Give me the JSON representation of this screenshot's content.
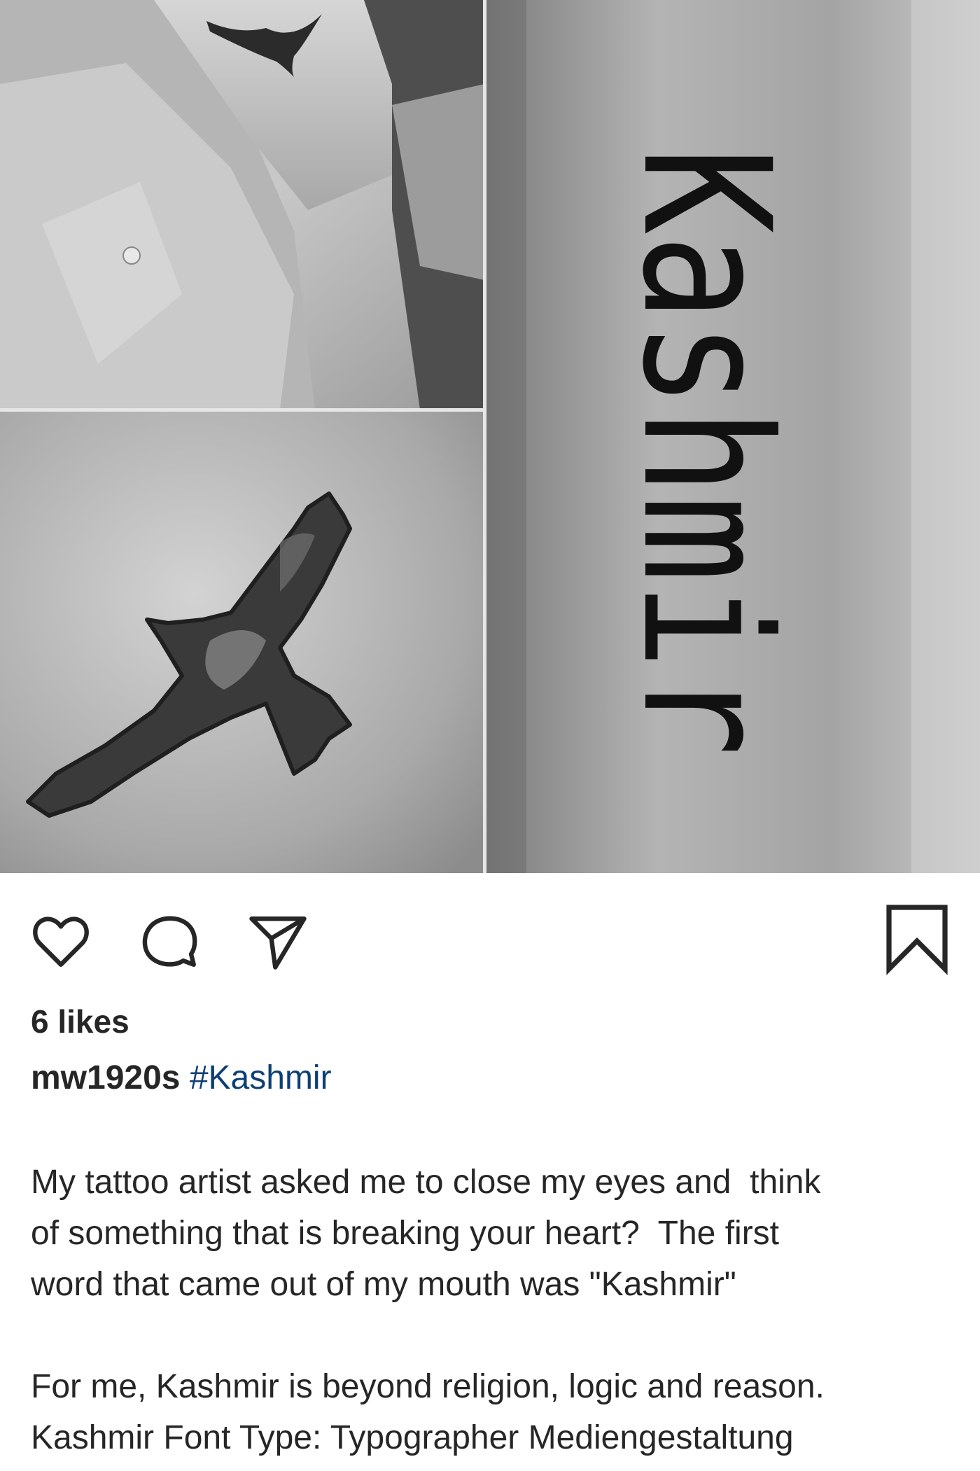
{
  "post": {
    "likes": "6 likes",
    "username": "mw1920s",
    "hashtag": "#Kashmir",
    "caption_lines": [
      "My tattoo artist asked me to close my eyes and  think",
      "of something that is breaking your heart?  The first",
      "word that came out of my mouth was \"Kashmir\""
    ],
    "caption_lines_2": [
      "For me, Kashmir is beyond religion, logic and reason.",
      "Kashmir Font Type: Typographer Mediengestaltung"
    ]
  },
  "photos": {
    "tattoo_text": "Kashmir"
  },
  "actions": {
    "like_icon": "heart-icon",
    "comment_icon": "comment-icon",
    "share_icon": "paper-plane-icon",
    "save_icon": "bookmark-icon"
  },
  "colors": {
    "hashtag": "#0d3f74",
    "text": "#262626"
  }
}
